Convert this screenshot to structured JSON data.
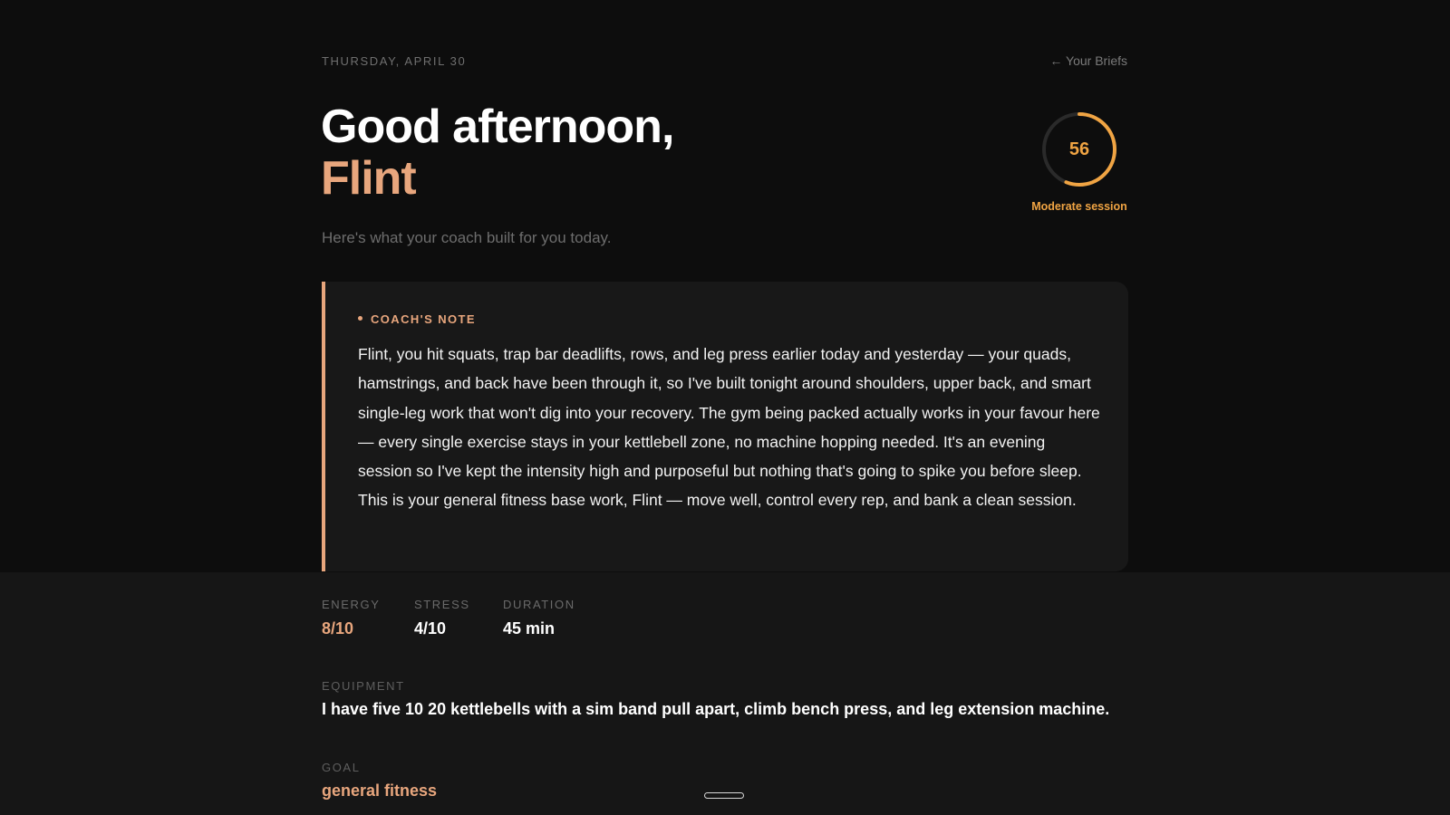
{
  "header": {
    "date": "THURSDAY, APRIL 30",
    "back_link": "← Your Briefs"
  },
  "greeting": {
    "line1": "Good afternoon,",
    "name": "Flint",
    "subtitle": "Here's what your coach built for you today."
  },
  "score": {
    "value": 56,
    "max": 100,
    "label": "Moderate session",
    "ring_color": "#f0a443",
    "track_color": "#2a2a2a"
  },
  "coach_note": {
    "title": "COACH'S NOTE",
    "text": "Flint, you hit squats, trap bar deadlifts, rows, and leg press earlier today and yesterday — your quads, hamstrings, and back have been through it, so I've built tonight around shoulders, upper back, and smart single-leg work that won't dig into your recovery. The gym being packed actually works in your favour here — every single exercise stays in your kettlebell zone, no machine hopping needed. It's an evening session so I've kept the intensity high and purposeful but nothing that's going to spike you before sleep. This is your general fitness base work, Flint — move well, control every rep, and bank a clean session."
  },
  "stats": [
    {
      "label": "ENERGY",
      "value": "8/10"
    },
    {
      "label": "STRESS",
      "value": "4/10"
    },
    {
      "label": "DURATION",
      "value": "45 min"
    }
  ],
  "equipment": {
    "label": "EQUIPMENT",
    "value": "I have five 10 20 kettlebells with a sim band pull apart, climb bench press, and leg extension machine."
  },
  "goal": {
    "label": "GOAL",
    "value": "general fitness"
  },
  "colors": {
    "accent": "#e8a67d",
    "score": "#f0a443",
    "background": "#0d0d0d",
    "card": "#181818"
  }
}
